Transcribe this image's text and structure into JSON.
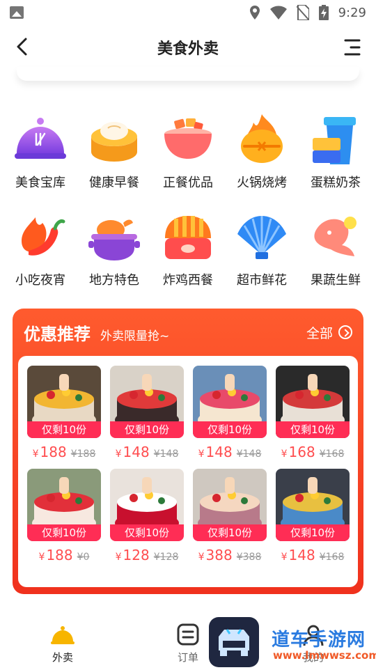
{
  "status": {
    "time": "9:29"
  },
  "header": {
    "title": "美食外卖"
  },
  "categories": [
    {
      "label": "美食宝库",
      "icon": "cloche-icon"
    },
    {
      "label": "健康早餐",
      "icon": "dumpling-steamer-icon"
    },
    {
      "label": "正餐优品",
      "icon": "meal-bowl-icon"
    },
    {
      "label": "火锅烧烤",
      "icon": "hotpot-flame-icon"
    },
    {
      "label": "蛋糕奶茶",
      "icon": "milk-tea-icon"
    },
    {
      "label": "小吃夜宵",
      "icon": "chili-pepper-icon"
    },
    {
      "label": "地方特色",
      "icon": "roast-chicken-pot-icon"
    },
    {
      "label": "炸鸡西餐",
      "icon": "sushi-icon"
    },
    {
      "label": "超市鲜花",
      "icon": "shell-icon"
    },
    {
      "label": "果蔬生鲜",
      "icon": "fish-icon"
    }
  ],
  "promo": {
    "title": "优惠推荐",
    "subtitle": "外卖限量抢~",
    "all_label": "全部",
    "currency": "¥",
    "products": [
      {
        "tag": "仅剩10份",
        "price": "188",
        "old_price": "¥188"
      },
      {
        "tag": "仅剩10份",
        "price": "148",
        "old_price": "¥148"
      },
      {
        "tag": "仅剩10份",
        "price": "148",
        "old_price": "¥148"
      },
      {
        "tag": "仅剩10份",
        "price": "168",
        "old_price": "¥168"
      },
      {
        "tag": "仅剩10份",
        "price": "188",
        "old_price": "¥0"
      },
      {
        "tag": "仅剩10份",
        "price": "128",
        "old_price": "¥128"
      },
      {
        "tag": "仅剩10份",
        "price": "388",
        "old_price": "¥388"
      },
      {
        "tag": "仅剩10份",
        "price": "148",
        "old_price": "¥168"
      }
    ]
  },
  "tabbar": {
    "items": [
      {
        "label": "外卖",
        "active": true
      },
      {
        "label": "订单",
        "active": false
      },
      {
        "label": "我的",
        "active": false
      }
    ]
  },
  "watermark": {
    "line1": "道车手游网",
    "line2": "www.lmwwsz.com"
  },
  "colors": {
    "accent": "#ff4d1f",
    "tag": "#ff2d55",
    "price": "#ff4d4f",
    "tab_active": "#f7b500"
  }
}
